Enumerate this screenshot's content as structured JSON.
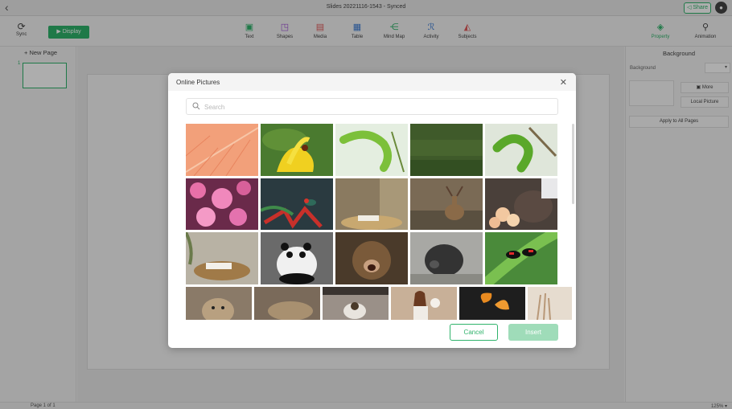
{
  "window": {
    "title": "Slides 20221116-1543 - Synced",
    "back_icon": "chevron-left-icon",
    "share_label": "Share",
    "avatar_icon": "user-avatar-icon"
  },
  "toolbar": {
    "sync_label": "Sync",
    "display_label": "Display",
    "tools": [
      {
        "label": "Text",
        "icon": "text-icon"
      },
      {
        "label": "Shapes",
        "icon": "shapes-icon"
      },
      {
        "label": "Media",
        "icon": "media-icon"
      },
      {
        "label": "Table",
        "icon": "table-icon"
      },
      {
        "label": "Mind Map",
        "icon": "mind-map-icon"
      },
      {
        "label": "Activity",
        "icon": "activity-icon"
      },
      {
        "label": "Subjects",
        "icon": "subjects-icon"
      }
    ],
    "property_label": "Property",
    "animation_label": "Animation"
  },
  "left_panel": {
    "new_page_label": "+ New Page",
    "thumbnail_number": "1"
  },
  "right_panel": {
    "title": "Background",
    "background_label": "Background",
    "more_label": "More",
    "local_picture_label": "Local Picture",
    "apply_all_label": "Apply to All Pages"
  },
  "status": {
    "page_count": "Page 1 of 1",
    "zoom": "125% ▾"
  },
  "dialog": {
    "title": "Online Pictures",
    "search_placeholder": "Search",
    "cancel_label": "Cancel",
    "insert_label": "Insert",
    "pictures": [
      {
        "subject": "orange leaf"
      },
      {
        "subject": "yellow flower with insect"
      },
      {
        "subject": "green caterpillar"
      },
      {
        "subject": "green grass"
      },
      {
        "subject": "green caterpillar on branch"
      },
      {
        "subject": "pink flowers"
      },
      {
        "subject": "hummingbird with red flowers"
      },
      {
        "subject": "room interior with table"
      },
      {
        "subject": "deer"
      },
      {
        "subject": "cow with flowers"
      },
      {
        "subject": "wooden table with book"
      },
      {
        "subject": "panda"
      },
      {
        "subject": "monkey"
      },
      {
        "subject": "black pig"
      },
      {
        "subject": "butterfly on leaf"
      },
      {
        "subject": "lynx"
      },
      {
        "subject": "lynx lying"
      },
      {
        "subject": "dog on sofa"
      },
      {
        "subject": "woman with dog"
      },
      {
        "subject": "orange butterfly"
      },
      {
        "subject": "dried grass"
      }
    ]
  },
  "colors": {
    "accent": "#2fb36b",
    "insert_disabled": "#9fdcb9"
  }
}
